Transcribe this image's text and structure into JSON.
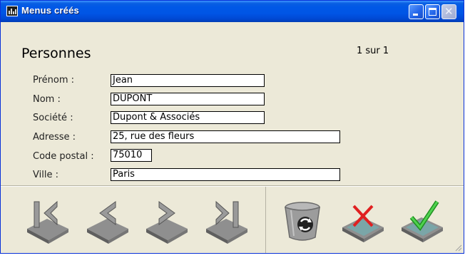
{
  "window": {
    "title": "Menus créés"
  },
  "form": {
    "heading": "Personnes",
    "pager": "1 sur 1",
    "fields": [
      {
        "label": "Prénom :",
        "value": "Jean"
      },
      {
        "label": "Nom :",
        "value": "DUPONT"
      },
      {
        "label": "Société :",
        "value": "Dupont & Associés"
      },
      {
        "label": "Adresse :",
        "value": "25, rue des fleurs"
      },
      {
        "label": "Code postal :",
        "value": "75010"
      },
      {
        "label": "Ville :",
        "value": "Paris"
      }
    ]
  },
  "toolbar": {
    "buttons": [
      {
        "icon": "first-record-icon"
      },
      {
        "icon": "previous-record-icon"
      },
      {
        "icon": "next-record-icon"
      },
      {
        "icon": "last-record-icon"
      },
      {
        "icon": "recycle-bin-icon"
      },
      {
        "icon": "cancel-icon"
      },
      {
        "icon": "validate-icon"
      }
    ]
  },
  "colors": {
    "titlebar": "#0055e5",
    "window_bg": "#ece9d8",
    "check": "#2fae2f",
    "cross": "#e02020"
  }
}
